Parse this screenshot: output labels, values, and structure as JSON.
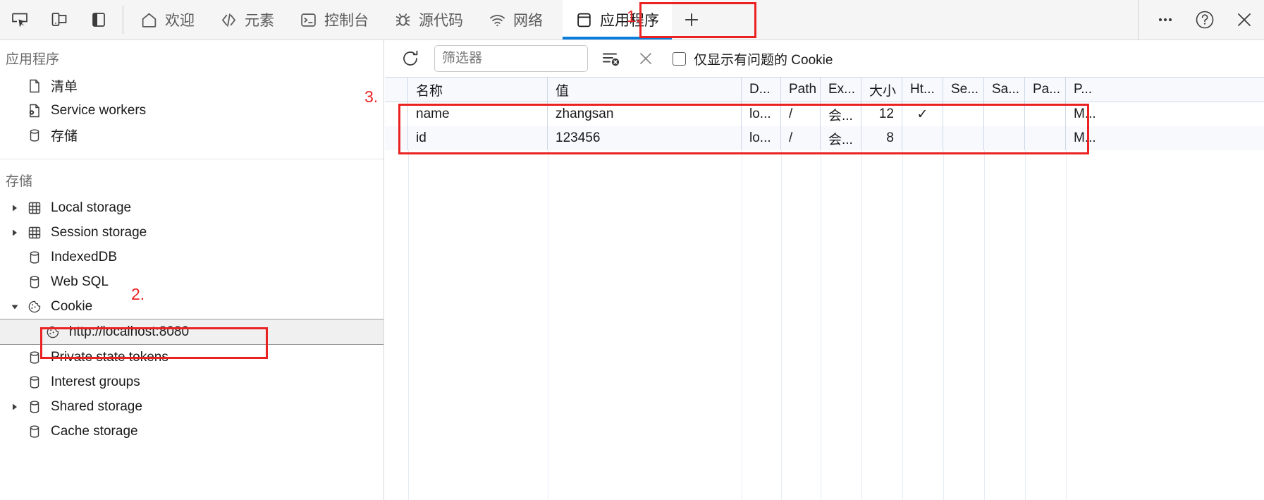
{
  "toolbar": {
    "left_icons": [
      {
        "name": "inspect-element-icon",
        "label": "检查元素"
      },
      {
        "name": "device-emulation-icon",
        "label": "设备模拟"
      },
      {
        "name": "dock-side-icon",
        "label": "停靠侧边"
      }
    ],
    "tabs": [
      {
        "id": "welcome",
        "label": "欢迎",
        "icon": "home-icon",
        "active": false
      },
      {
        "id": "elements",
        "label": "元素",
        "icon": "code-icon",
        "active": false
      },
      {
        "id": "console",
        "label": "控制台",
        "icon": "terminal-icon",
        "active": false
      },
      {
        "id": "sources",
        "label": "源代码",
        "icon": "bug-icon",
        "active": false
      },
      {
        "id": "network",
        "label": "网络",
        "icon": "wifi-icon",
        "active": false
      },
      {
        "id": "application",
        "label": "应用程序",
        "icon": "app-panel-icon",
        "active": true
      }
    ],
    "add_tab_label": "+",
    "right_icons": [
      {
        "name": "more-options-icon",
        "label": "···"
      },
      {
        "name": "help-icon",
        "label": "?"
      },
      {
        "name": "close-icon",
        "label": "✕"
      }
    ]
  },
  "sidebar": {
    "application_section": {
      "title": "应用程序",
      "items": [
        {
          "label": "清单",
          "icon": "manifest-file-icon",
          "twisty": "none"
        },
        {
          "label": "Service workers",
          "icon": "service-worker-icon",
          "twisty": "none"
        },
        {
          "label": "存储",
          "icon": "storage-cylinder-icon",
          "twisty": "none"
        }
      ]
    },
    "storage_section": {
      "title": "存储",
      "items": [
        {
          "label": "Local storage",
          "icon": "table-grid-icon",
          "twisty": "collapsed",
          "selected": false
        },
        {
          "label": "Session storage",
          "icon": "table-grid-icon",
          "twisty": "collapsed",
          "selected": false
        },
        {
          "label": "IndexedDB",
          "icon": "storage-cylinder-icon",
          "twisty": "none",
          "selected": false
        },
        {
          "label": "Web SQL",
          "icon": "storage-cylinder-icon",
          "twisty": "none",
          "selected": false
        },
        {
          "label": "Cookie",
          "icon": "cookie-icon",
          "twisty": "expanded",
          "selected": false
        },
        {
          "label": "http://localhost:8080",
          "icon": "cookie-icon",
          "twisty": "none",
          "selected": true,
          "child": true
        },
        {
          "label": "Private state tokens",
          "icon": "storage-cylinder-icon",
          "twisty": "none",
          "selected": false
        },
        {
          "label": "Interest groups",
          "icon": "storage-cylinder-icon",
          "twisty": "none",
          "selected": false
        },
        {
          "label": "Shared storage",
          "icon": "storage-cylinder-icon",
          "twisty": "collapsed",
          "selected": false
        },
        {
          "label": "Cache storage",
          "icon": "storage-cylinder-icon",
          "twisty": "none",
          "selected": false
        }
      ]
    }
  },
  "cookie_panel": {
    "refresh_label": "刷新",
    "filter": {
      "value": "",
      "placeholder": "筛选器"
    },
    "clear_all_label": "清除所有 Cookie",
    "delete_label": "删除所选 Cookie",
    "only_problem_checkbox": {
      "label": "仅显示有问题的 Cookie",
      "checked": false
    },
    "table": {
      "columns": [
        {
          "key": "name",
          "label": "名称"
        },
        {
          "key": "value",
          "label": "值"
        },
        {
          "key": "domain",
          "label": "D..."
        },
        {
          "key": "path",
          "label": "Path"
        },
        {
          "key": "expires",
          "label": "Ex..."
        },
        {
          "key": "size",
          "label": "大小"
        },
        {
          "key": "httponly",
          "label": "Ht..."
        },
        {
          "key": "secure",
          "label": "Se..."
        },
        {
          "key": "samesite",
          "label": "Sa..."
        },
        {
          "key": "partition",
          "label": "Pa..."
        },
        {
          "key": "priority",
          "label": "P..."
        }
      ],
      "rows": [
        {
          "name": "name",
          "value": "zhangsan",
          "domain": "lo...",
          "path": "/",
          "expires": "会...",
          "size": "12",
          "httponly": "✓",
          "secure": "",
          "samesite": "",
          "partition": "",
          "priority": "M..."
        },
        {
          "name": "id",
          "value": "123456",
          "domain": "lo...",
          "path": "/",
          "expires": "会...",
          "size": "8",
          "httponly": "",
          "secure": "",
          "samesite": "",
          "partition": "",
          "priority": "M..."
        }
      ]
    }
  },
  "annotations": [
    {
      "id": "1",
      "number": "1.",
      "target": "application-tab"
    },
    {
      "id": "2",
      "number": "2.",
      "target": "cookie-origin-row"
    },
    {
      "id": "3",
      "number": "3.",
      "target": "cookie-table-rows"
    }
  ],
  "colors": {
    "accent_blue": "#0a7ddb",
    "annotation_red": "#ea2222",
    "toolbar_bg": "#f5f5f5",
    "table_header_bg": "#f7f9fd",
    "selection_bg": "#f0f0f0"
  }
}
